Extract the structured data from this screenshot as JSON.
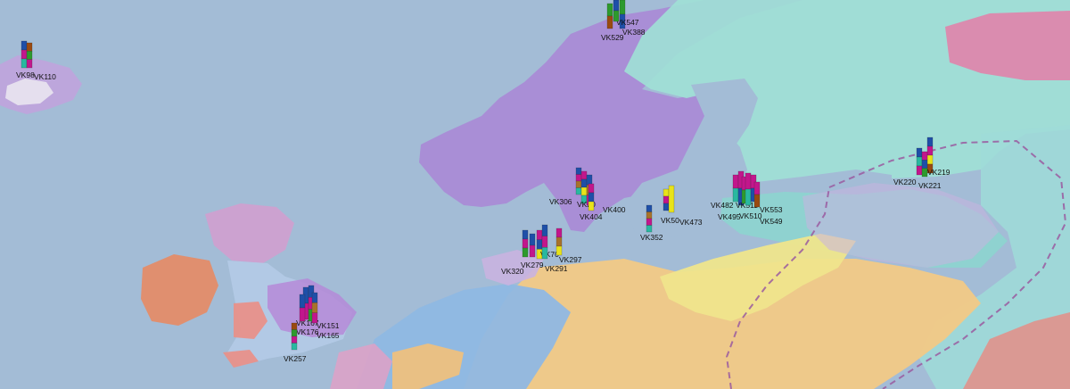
{
  "map": {
    "colors": {
      "sea": "#a3bcd6",
      "scandinavia": "#a98ad6",
      "finland": "#9fe0d6",
      "east_europe": "#f2c986",
      "yellow_zone": "#efe58c",
      "ireland": "#e08f6f",
      "britain": "#cfa0d0",
      "central_europe": "#8fb8e3",
      "boundary": "#9a5aa0"
    },
    "samples": [
      {
        "label": "VK98",
        "stack": [
          "#1e4fa8",
          "#c2168c",
          "#29b8a0"
        ]
      },
      {
        "label": "VK110",
        "stack": [
          "#9a4a10",
          "#2d9a2d",
          "#c2168c"
        ]
      },
      {
        "label": "VK529",
        "stack": [
          "#2d9a2d",
          "#9a4a10"
        ]
      },
      {
        "label": "VK547",
        "stack": [
          "#2d9a2d",
          "#1e4fa8"
        ]
      },
      {
        "label": "VK388",
        "stack": [
          "#1e4fa8",
          "#2d9a2d"
        ]
      },
      {
        "label": "VK306",
        "stack": [
          "#1e4fa8",
          "#c2168c",
          "#a8722a",
          "#29b8a0"
        ]
      },
      {
        "label": "VK20",
        "stack": [
          "#c2168c",
          "#1e4fa8",
          "#e8e31a",
          "#29b8a0"
        ]
      },
      {
        "label": "VK400",
        "stack": [
          "#1e4fa8",
          "#a8722a",
          "#c2168c"
        ]
      },
      {
        "label": "VK404",
        "stack": [
          "#c2168c",
          "#1e4fa8",
          "#e8e31a"
        ]
      },
      {
        "label": "VK320",
        "stack": [
          "#1e4fa8",
          "#c2168c",
          "#2d9a2d"
        ]
      },
      {
        "label": "VK279",
        "stack": [
          "#1e4fa8",
          "#c2168c"
        ]
      },
      {
        "label": "VK70",
        "stack": [
          "#c2168c",
          "#1e4fa8",
          "#e8e31a"
        ]
      },
      {
        "label": "VK291",
        "stack": [
          "#1e4fa8",
          "#c2168c",
          "#29b8a0"
        ]
      },
      {
        "label": "VK297",
        "stack": [
          "#c2168c",
          "#a8722a",
          "#e8e31a"
        ]
      },
      {
        "label": "VK352",
        "stack": [
          "#1e4fa8",
          "#a8722a",
          "#c2168c",
          "#29b8a0"
        ]
      },
      {
        "label": "VK50",
        "stack": [
          "#e8e31a",
          "#c2168c",
          "#1e4fa8"
        ]
      },
      {
        "label": "VK473",
        "stack": [
          "#e8e31a"
        ]
      },
      {
        "label": "VK482",
        "stack": [
          "#c2168c",
          "#29b8a0"
        ]
      },
      {
        "label": "VK511",
        "stack": [
          "#c2168c",
          "#1e4fa8"
        ]
      },
      {
        "label": "VK495",
        "stack": [
          "#c2168c",
          "#2d9a2d"
        ]
      },
      {
        "label": "VK510",
        "stack": [
          "#c2168c",
          "#29b8a0"
        ]
      },
      {
        "label": "VK553",
        "stack": [
          "#c2168c",
          "#1e4fa8"
        ]
      },
      {
        "label": "VK549",
        "stack": [
          "#c2168c",
          "#9a4a10"
        ]
      },
      {
        "label": "VK220",
        "stack": [
          "#1e4fa8",
          "#29b8a0",
          "#c2168c"
        ]
      },
      {
        "label": "VK219",
        "stack": [
          "#1e4fa8",
          "#c2168c",
          "#e8e31a",
          "#9a4a10"
        ]
      },
      {
        "label": "VK221",
        "stack": [
          "#c2168c",
          "#1e4fa8",
          "#2d9a2d"
        ]
      },
      {
        "label": "VK167",
        "stack": [
          "#1e4fa8",
          "#c2168c"
        ]
      },
      {
        "label": "VK151",
        "stack": [
          "#1e4fa8",
          "#c2168c",
          "#2d9a2d"
        ]
      },
      {
        "label": "VK176",
        "stack": [
          "#1e4fa8",
          "#c2168c"
        ]
      },
      {
        "label": "VK165",
        "stack": [
          "#1e4fa8",
          "#a8722a",
          "#c2168c"
        ]
      },
      {
        "label": "VK257",
        "stack": [
          "#9a4a10",
          "#2d9a2d",
          "#c2168c",
          "#29b8a0"
        ]
      }
    ]
  }
}
